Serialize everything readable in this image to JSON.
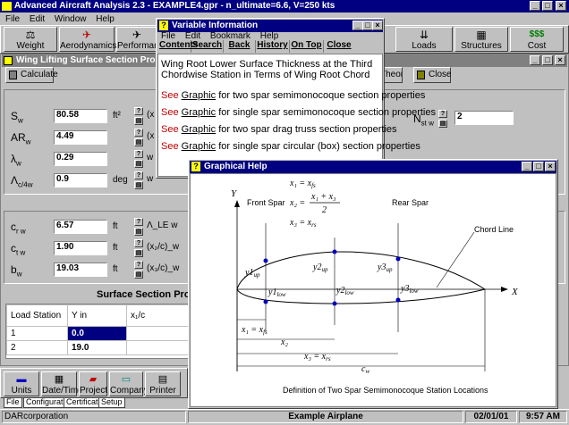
{
  "app": {
    "title": "Advanced Aircraft Analysis 2.3 - EXAMPLE4.gpr - n_ultimate=6.6, V=250 kts",
    "menu": [
      "File",
      "Edit",
      "Window",
      "Help"
    ],
    "toolbar": [
      "Weight",
      "Aerodynamics",
      "Performance",
      "Loads",
      "Structures",
      "Cost"
    ],
    "cost_icon_text": "$$$"
  },
  "wing_window": {
    "title": "Wing Lifting Surface Section Properties: n_u",
    "calculate_label": "Calculate",
    "theory_label": "Theory",
    "close_label": "Close",
    "params": [
      {
        "sym": "S",
        "sub": "w",
        "value": "80.58",
        "unit": "ft²"
      },
      {
        "sym": "AR",
        "sub": "w",
        "value": "4.49",
        "unit": ""
      },
      {
        "sym": "λ",
        "sub": "w",
        "value": "0.29",
        "unit": ""
      },
      {
        "sym": "Λ",
        "sub": "c/4w",
        "value": "0.9",
        "unit": "deg"
      }
    ],
    "params2": [
      {
        "sym": "c",
        "sub": "r w",
        "value": "6.57",
        "unit": "ft"
      },
      {
        "sym": "c",
        "sub": "t w",
        "value": "1.90",
        "unit": "ft"
      },
      {
        "sym": "b",
        "sub": "w",
        "value": "19.03",
        "unit": "ft"
      }
    ],
    "partial_labels": [
      "(x",
      "(x",
      "w",
      "w"
    ],
    "partial_labels2": [
      "Λ_LE w",
      "(x₂/c)_w",
      "(x₃/c)_w"
    ],
    "nst_label": "N",
    "nst_sub": "st w",
    "nst_value": "2",
    "section_title": "Surface Section Propertie",
    "table": {
      "headers": [
        "Load Station",
        "Y  in",
        "x₁/c"
      ],
      "rows": [
        {
          "station": "1",
          "y": "0.0"
        },
        {
          "station": "2",
          "y": "19.0"
        }
      ]
    }
  },
  "variable_info": {
    "title": "Variable Information",
    "menu": [
      "File",
      "Edit",
      "Bookmark",
      "Help"
    ],
    "buttons": [
      "Contents",
      "Search",
      "Back",
      "History",
      "On Top",
      "Close"
    ],
    "heading": "Wing Root Lower Surface Thickness at the Third Chordwise Station in Terms of Wing Root Chord",
    "see_word": "See",
    "graphic_word": "Graphic",
    "links": [
      "for two spar semimonocoque section properties",
      "for single spar semimonocoque section properties",
      "for two spar drag truss section properties",
      "for single spar circular (box) section properties"
    ]
  },
  "graphical_help": {
    "title": "Graphical Help",
    "eq1": "x₁ = x_fs",
    "eq2_lhs": "x₂ =",
    "eq2_num": "x₁ + x₃",
    "eq2_den": "2",
    "eq3": "x₃ = x_rs",
    "axis_y": "Y",
    "axis_x": "X",
    "front_spar": "Front Spar",
    "rear_spar": "Rear Spar",
    "chord_line": "Chord Line",
    "labels": [
      "y1up",
      "y1low",
      "y2up",
      "y2low",
      "y3up",
      "y3low"
    ],
    "dim_x1": "x₁ = x_fs",
    "dim_x2": "x₂",
    "dim_x3": "x₃ = x_rs",
    "dim_cw": "c_w",
    "caption": "Definition of Two Spar Semimonocoque Station Locations"
  },
  "bottom_toolbar": [
    "Units",
    "Date/Time",
    "Project",
    "Company",
    "Printer"
  ],
  "tabs": [
    "File",
    "Configuration",
    "Certification",
    "Setup"
  ],
  "status": {
    "company": "DARcorporation",
    "project": "Example Airplane",
    "date": "02/01/01",
    "time": "9:57 AM"
  }
}
